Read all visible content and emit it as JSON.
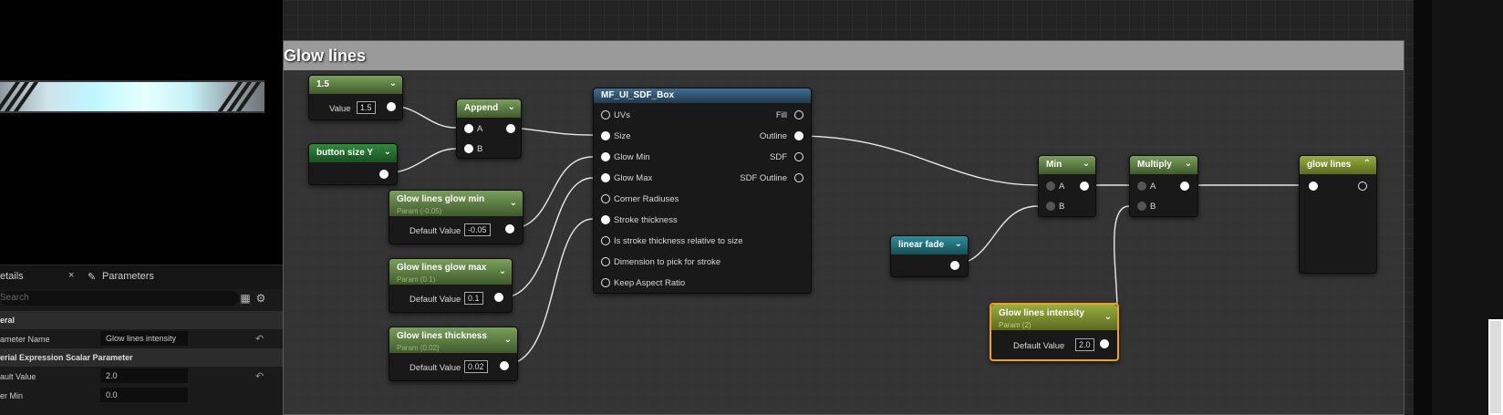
{
  "preview": {},
  "details": {
    "tab_details": "etails",
    "tab_details_close": "×",
    "tab_parameters": "Parameters",
    "search_placeholder": "Search",
    "section_general": "eral",
    "param_name_label": "ameter Name",
    "param_name_value": "Glow lines intensity",
    "section_scalar": "erial Expression Scalar Parameter",
    "default_value_label": "ault Value",
    "default_value_value": "2.0",
    "slider_min_label": "er Min",
    "slider_min_value": "0.0"
  },
  "comment": {
    "title": "Glow lines"
  },
  "nodes": {
    "const": {
      "title": "1.5",
      "value_label": "Value",
      "value": "1.5"
    },
    "append": {
      "title": "Append",
      "a": "A",
      "b": "B"
    },
    "button_size_y": {
      "title": "button size Y"
    },
    "glow_min": {
      "title": "Glow lines glow min",
      "sub": "Param (-0.05)",
      "dv_label": "Default Value",
      "dv": "-0.05"
    },
    "glow_max": {
      "title": "Glow lines glow max",
      "sub": "Param (0.1)",
      "dv_label": "Default Value",
      "dv": "0.1"
    },
    "glow_thickness": {
      "title": "Glow lines thickness",
      "sub": "Param (0.02)",
      "dv_label": "Default Value",
      "dv": "0.02"
    },
    "sdf_box": {
      "title": "MF_UI_SDF_Box",
      "inputs": [
        "UVs",
        "Size",
        "Glow Min",
        "Glow Max",
        "Corner Radiuses",
        "Stroke thickness",
        "Is stroke thickness relative to size",
        "Dimension to pick for stroke",
        "Keep Aspect Ratio"
      ],
      "outputs": [
        "Fill",
        "Outline",
        "SDF",
        "SDF Outline"
      ]
    },
    "linear_fade": {
      "title": "linear fade"
    },
    "min": {
      "title": "Min",
      "a": "A",
      "b": "B"
    },
    "multiply": {
      "title": "Multiply",
      "a": "A",
      "b": "B"
    },
    "intensity": {
      "title": "Glow lines intensity",
      "sub": "Param (2)",
      "dv_label": "Default Value",
      "dv": "2.0"
    },
    "glow_lines_out": {
      "title": "glow lines"
    }
  }
}
